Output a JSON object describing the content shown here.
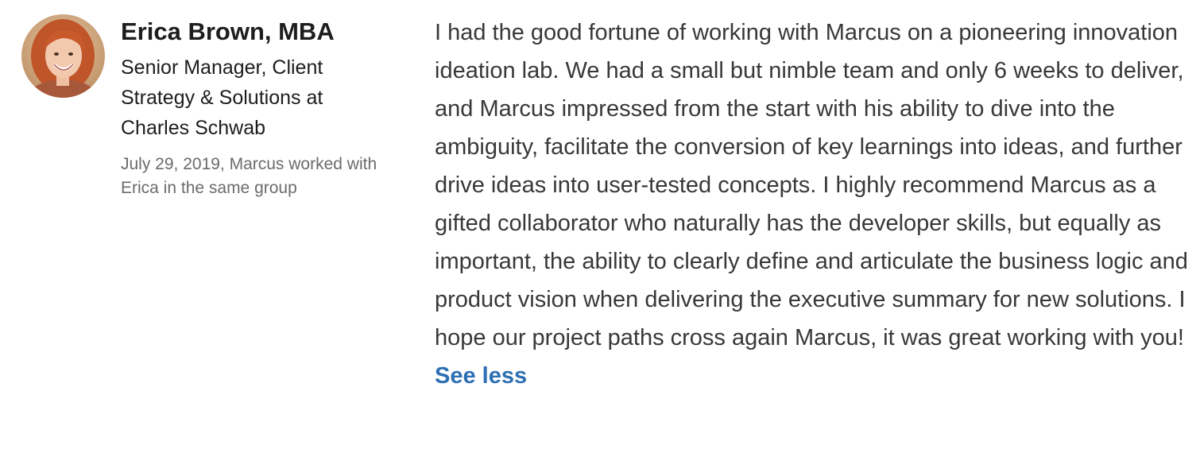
{
  "recommendation": {
    "author": {
      "name": "Erica Brown, MBA",
      "headline": "Senior Manager, Client Strategy & Solutions at Charles Schwab",
      "avatar_icon": "profile-photo"
    },
    "meta": "July 29, 2019, Marcus worked with Erica in the same group",
    "text": "I had the good fortune of working with Marcus on a pioneering innovation ideation lab. We had a small but nimble team and only 6 weeks to deliver, and Marcus impressed from the start with his ability to dive into the ambiguity, facilitate the conversion of key learnings into ideas, and further drive ideas into user-tested concepts. I highly recommend Marcus as a gifted collaborator who naturally has the developer skills, but equally as important, the ability to clearly define and articulate the business logic and product vision when delivering the executive summary for new solutions. I hope our project paths cross again Marcus, it was great working with you!",
    "toggle_label": "See less"
  },
  "colors": {
    "link": "#2d6fb3",
    "body_text": "#383838",
    "meta_text": "#6b6b6b"
  }
}
